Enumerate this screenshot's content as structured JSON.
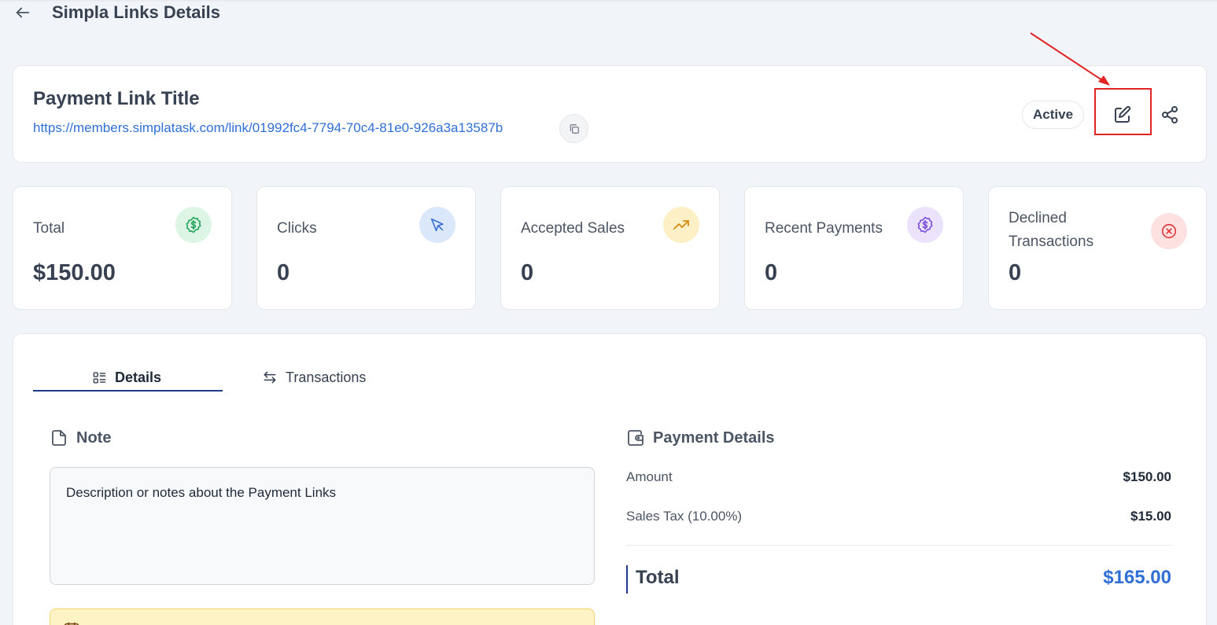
{
  "header": {
    "title": "Simpla Links Details"
  },
  "link": {
    "title": "Payment Link Title",
    "url": "https://members.simplatask.com/link/01992fc4-7794-70c4-81e0-926a3a13587b",
    "status": "Active"
  },
  "stats": [
    {
      "label": "Total",
      "value": "$150.00",
      "icon": "dollar-badge-icon",
      "color": "#22a55b",
      "bg": "#dcf5e4"
    },
    {
      "label": "Clicks",
      "value": "0",
      "icon": "cursor-icon",
      "color": "#3b6fd4",
      "bg": "#dbe7fb"
    },
    {
      "label": "Accepted Sales",
      "value": "0",
      "icon": "trending-up-icon",
      "color": "#d98a10",
      "bg": "#fdf0c6"
    },
    {
      "label": "Recent Payments",
      "value": "0",
      "icon": "dollar-badge-icon",
      "color": "#7c4ddb",
      "bg": "#ebe3fb"
    },
    {
      "label": "Declined Transactions",
      "value": "0",
      "icon": "x-circle-icon",
      "color": "#e0393e",
      "bg": "#fde1e1"
    }
  ],
  "tabs": {
    "details": "Details",
    "transactions": "Transactions"
  },
  "note": {
    "title": "Note",
    "text": "Description or notes about the Payment Links"
  },
  "payment_details": {
    "title": "Payment Details",
    "amount_label": "Amount",
    "amount_value": "$150.00",
    "tax_label": "Sales Tax (10.00%)",
    "tax_value": "$15.00",
    "total_label": "Total",
    "total_value": "$165.00"
  },
  "colors": {
    "accent": "#2f6fd6",
    "annotation": "#e02424",
    "tab_underline": "#1e3a8a"
  }
}
